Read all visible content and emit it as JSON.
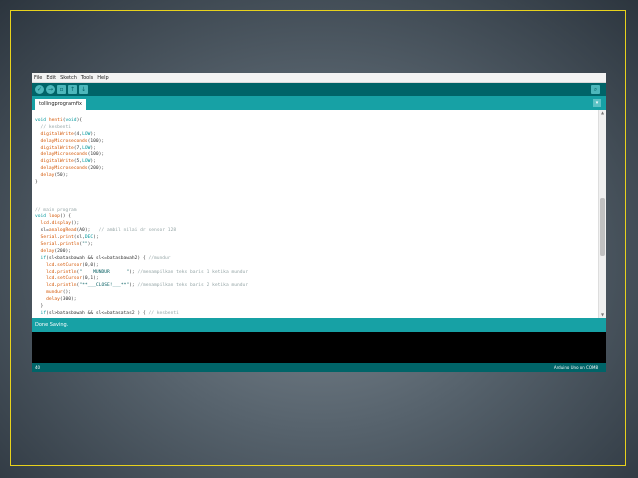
{
  "menu": [
    "File",
    "Edit",
    "Sketch",
    "Tools",
    "Help"
  ],
  "toolbar": {
    "verify_icon": "check-icon",
    "upload_icon": "arrow-right-icon",
    "new_icon": "new-file-icon",
    "open_icon": "arrow-up-icon",
    "save_icon": "arrow-down-icon",
    "serial_icon": "magnifier-icon"
  },
  "tab": {
    "label": "tollingprogramfix"
  },
  "code_lines": [
    "void henti(void){",
    "  // kesbenti",
    "  digitalWrite(4,LOW);",
    "  delayMicroseconds(100);",
    "  digitalWrite(7,LOW);",
    "  delayMicroseconds(100);",
    "  digitalWrite(5,LOW);",
    "  delayMicroseconds(200);",
    "  delay(50);",
    "}",
    "",
    "",
    "",
    "// main program",
    "void loop() {",
    "  lcd.display();",
    "  sl=analogRead(A0);   // ambil nilai dr sensor 128",
    "  Serial.print(sl,DEC);",
    "  Serial.println(\"\");",
    "  delay(200);",
    "  if(sl<batasbawah && sl<=batasbawah2) { //mundur",
    "    lcd.setCursor(0,0);",
    "    lcd.println(\"    MUNDUR      \"); //menampilkan teks baris 1 ketika mundur",
    "    lcd.setCursor(0,1);",
    "    lcd.println(\"**___CLOSE!___**\"); //menampilkan teks baris 2 ketika mundur",
    "    mundur();",
    "    delay(300);",
    "  }",
    "  if(sl>batasbawah && sl<=batasatas2 ) { // kesbenti"
  ],
  "status": {
    "text": "Done Saving."
  },
  "footer": {
    "line": "40",
    "board": "Arduino Uno on COM8"
  },
  "colors": {
    "toolbar": "#006468",
    "tabbar": "#17a1a5",
    "frame": "#e8d21c"
  }
}
